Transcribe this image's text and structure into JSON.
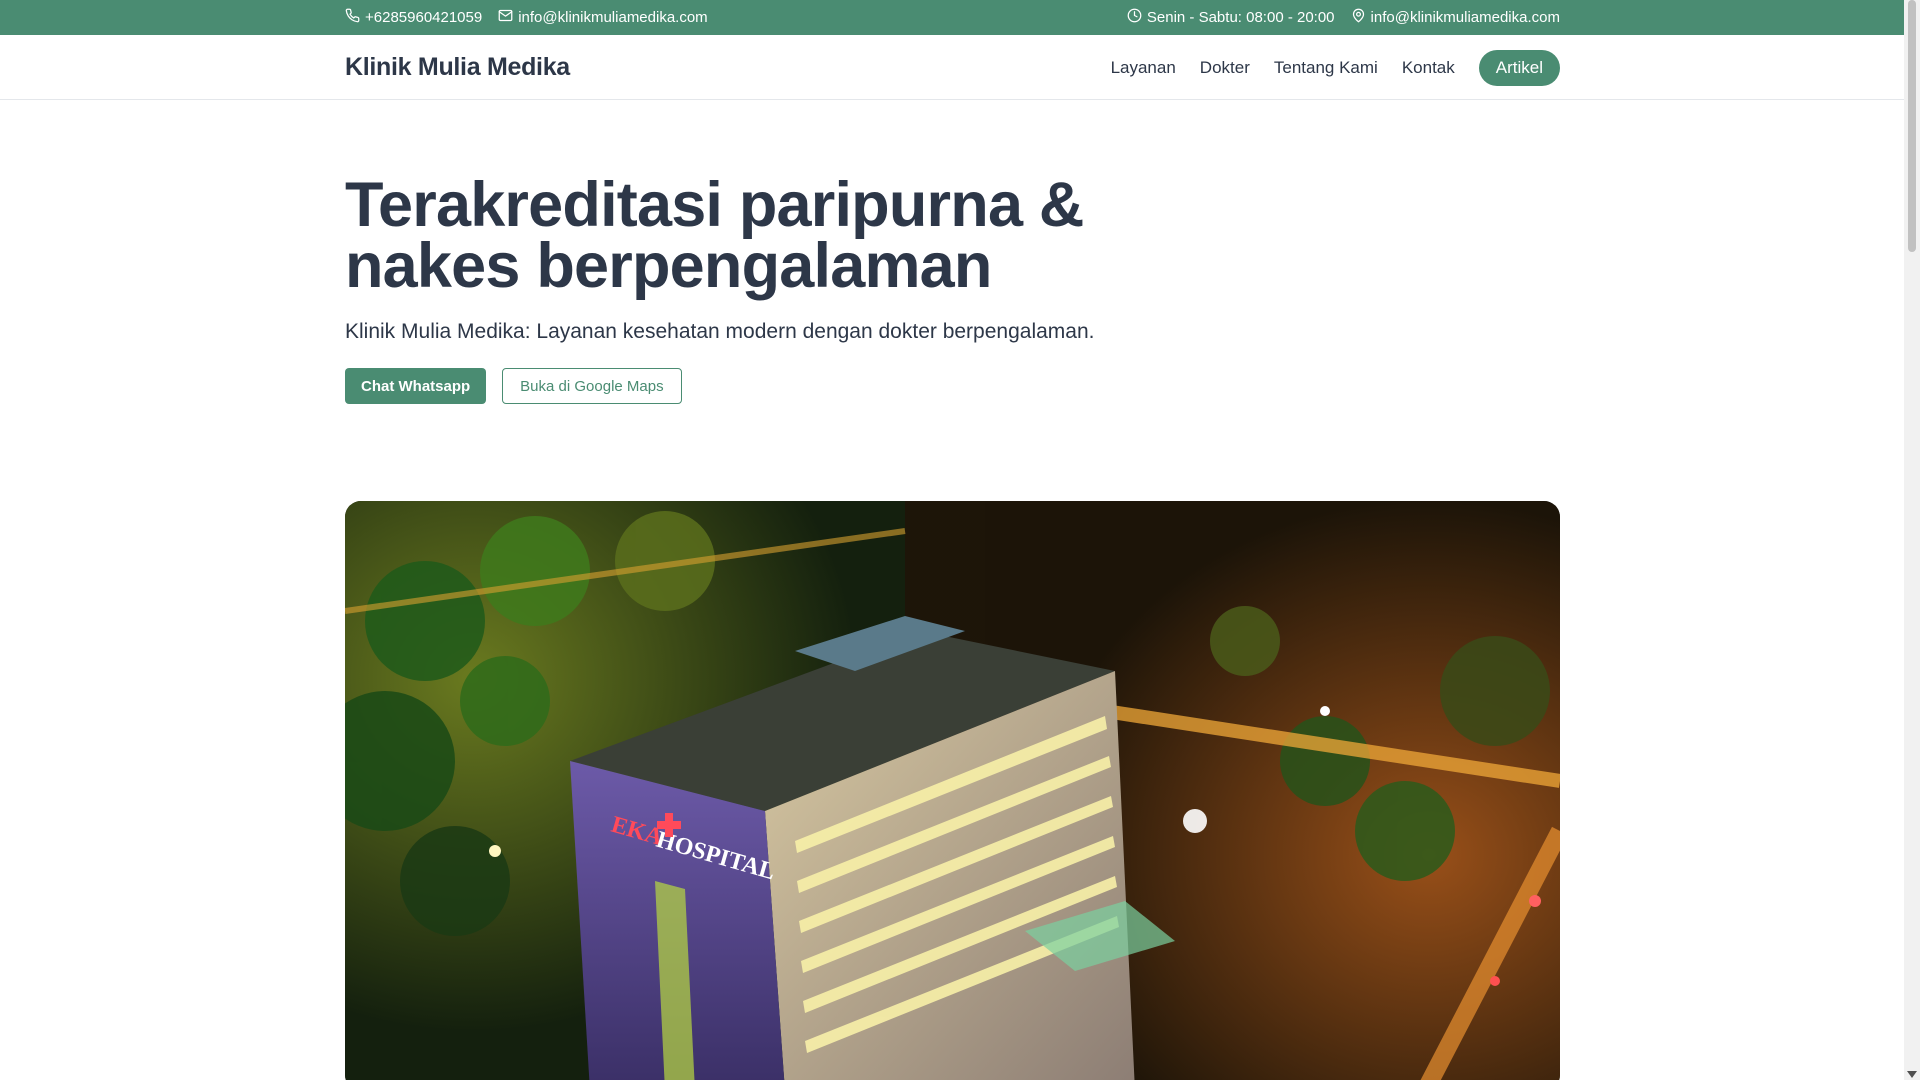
{
  "topbar": {
    "phone": "+6285960421059",
    "email": "info@klinikmuliamedika.com",
    "hours": "Senin - Sabtu: 08:00 - 20:00",
    "location": "info@klinikmuliamedika.com"
  },
  "navbar": {
    "brand": "Klinik Mulia Medika",
    "links": [
      "Layanan",
      "Dokter",
      "Tentang Kami",
      "Kontak"
    ],
    "cta": "Artikel"
  },
  "hero": {
    "title": "Terakreditasi paripurna & nakes berpengalaman",
    "subtitle": "Klinik Mulia Medika: Layanan kesehatan modern dengan dokter berpengalaman.",
    "primary_button": "Chat Whatsapp",
    "secondary_button": "Buka di Google Maps",
    "image_sign": "EKA HOSPITAL"
  },
  "colors": {
    "brand_green": "#4a8c72",
    "text_dark": "#2d3748"
  },
  "icons": {
    "phone": "phone-icon",
    "email": "mail-icon",
    "hours": "clock-icon",
    "location": "map-pin-icon"
  }
}
